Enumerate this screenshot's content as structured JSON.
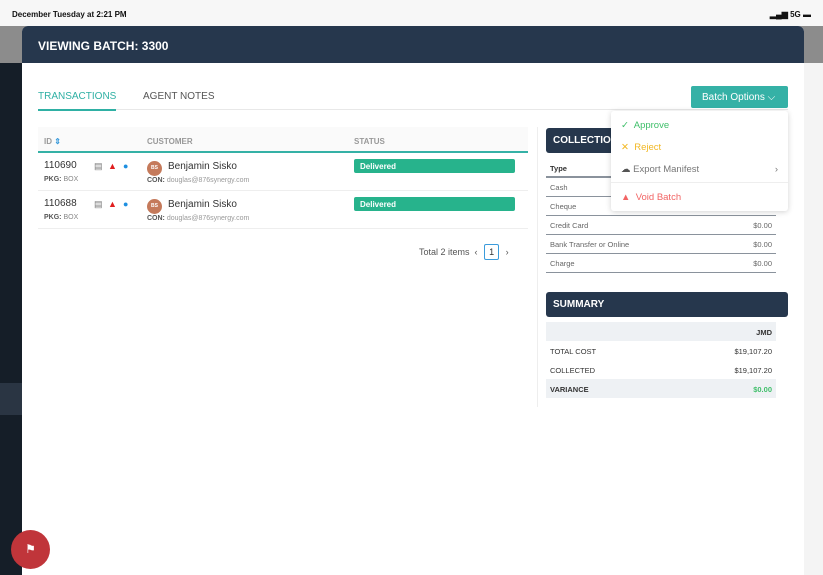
{
  "status_bar": {
    "time": "December Tuesday at 2:21 PM",
    "signal": "5G"
  },
  "modal": {
    "title": "VIEWING BATCH: 3300"
  },
  "tabs": [
    {
      "label": "TRANSACTIONS",
      "active": true
    },
    {
      "label": "AGENT NOTES",
      "active": false
    }
  ],
  "batch_options": {
    "label": "Batch Options",
    "menu": [
      {
        "label": "Approve",
        "color": "#3fbf6a",
        "icon": "check-icon"
      },
      {
        "label": "Reject",
        "color": "#f2b824",
        "icon": "x-icon"
      },
      {
        "label": "Export Manifest",
        "color": "#777777",
        "icon": "cloud-download-icon"
      },
      {
        "label": "Void Batch",
        "color": "#f26464",
        "icon": "warning-icon"
      }
    ]
  },
  "table": {
    "headers": [
      "ID",
      "CUSTOMER",
      "STATUS"
    ],
    "rows": [
      {
        "id": "110690",
        "pkg_label": "PKG:",
        "pkg": "BOX",
        "avatar": "BS",
        "name": "Benjamin Sisko",
        "con_label": "CON:",
        "email": "douglas@876synergy.com",
        "status": "Delivered"
      },
      {
        "id": "110688",
        "pkg_label": "PKG:",
        "pkg": "BOX",
        "avatar": "BS",
        "name": "Benjamin Sisko",
        "con_label": "CON:",
        "email": "douglas@876synergy.com",
        "status": "Delivered"
      }
    ]
  },
  "pagination": {
    "total": "Total 2 items",
    "page": "1"
  },
  "collection": {
    "title": "COLLECTION",
    "type_header": "Type",
    "rows": [
      {
        "type": "Cash",
        "value": ""
      },
      {
        "type": "Cheque",
        "value": ""
      },
      {
        "type": "Credit Card",
        "value": "$0.00"
      },
      {
        "type": "Bank Transfer or Online",
        "value": "$0.00"
      },
      {
        "type": "Charge",
        "value": "$0.00"
      }
    ]
  },
  "summary": {
    "title": "SUMMARY",
    "currency": "JMD",
    "rows": [
      {
        "label": "TOTAL COST",
        "value": "$19,107.20"
      },
      {
        "label": "COLLECTED",
        "value": "$19,107.20"
      },
      {
        "label": "VARIANCE",
        "value": "$0.00"
      }
    ]
  }
}
